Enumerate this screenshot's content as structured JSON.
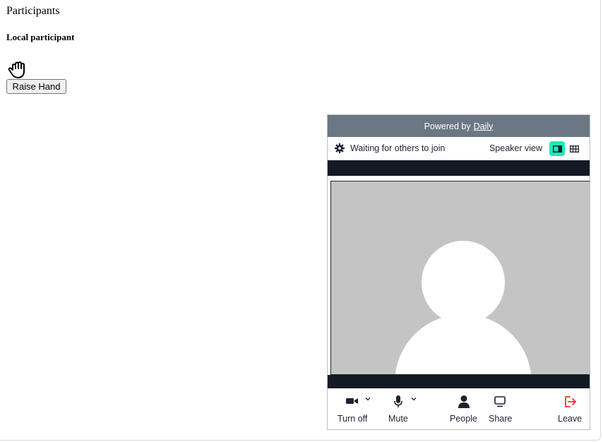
{
  "page": {
    "title": "Participants",
    "local_heading": "Local participant",
    "raise_hand_label": "Raise Hand"
  },
  "call": {
    "powered_prefix": "Powered by",
    "powered_link": "Daily",
    "status_text": "Waiting for others to join",
    "view_label": "Speaker view",
    "active_view": "speaker",
    "colors": {
      "header_bg": "#6b7785",
      "dark_strip": "#121a24",
      "accent": "#1bebb9",
      "leave": "#ff2d3b",
      "tile_bg": "#c4c4c4"
    },
    "tray": {
      "camera_label": "Turn off",
      "mic_label": "Mute",
      "people_label": "People",
      "share_label": "Share",
      "leave_label": "Leave"
    },
    "icons": [
      "raised-hand-icon",
      "gear-icon",
      "speaker-view-icon",
      "grid-view-icon",
      "camera-icon",
      "microphone-icon",
      "person-icon",
      "screen-share-icon",
      "leave-icon",
      "chevron-down-icon"
    ]
  }
}
